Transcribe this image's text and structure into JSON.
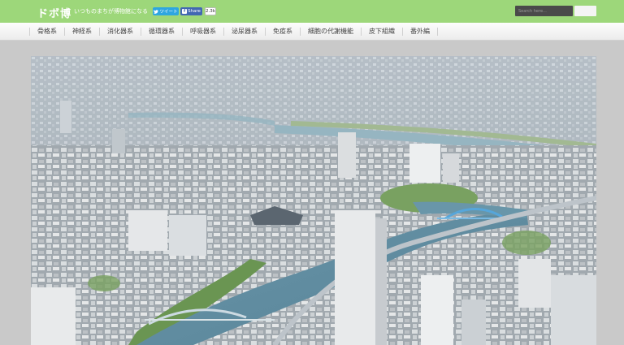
{
  "header": {
    "logo": "ドボ博",
    "tagline": "いつものまちが博物館になる",
    "tweet_label": "ツイート",
    "fb_share_label": "Share",
    "fb_count": "2.3k",
    "search_placeholder": "Search here..."
  },
  "nav": {
    "items": [
      {
        "label": "骨格系"
      },
      {
        "label": "神経系"
      },
      {
        "label": "消化器系"
      },
      {
        "label": "循環器系"
      },
      {
        "label": "呼吸器系"
      },
      {
        "label": "泌尿器系"
      },
      {
        "label": "免疫系"
      },
      {
        "label": "細胞の代謝機能"
      },
      {
        "label": "皮下組織"
      },
      {
        "label": "番外編"
      }
    ]
  },
  "colors": {
    "topbar": "#9dd77a",
    "tweet": "#2ea6e0",
    "facebook": "#4267b2",
    "background": "#c9c9c9"
  }
}
